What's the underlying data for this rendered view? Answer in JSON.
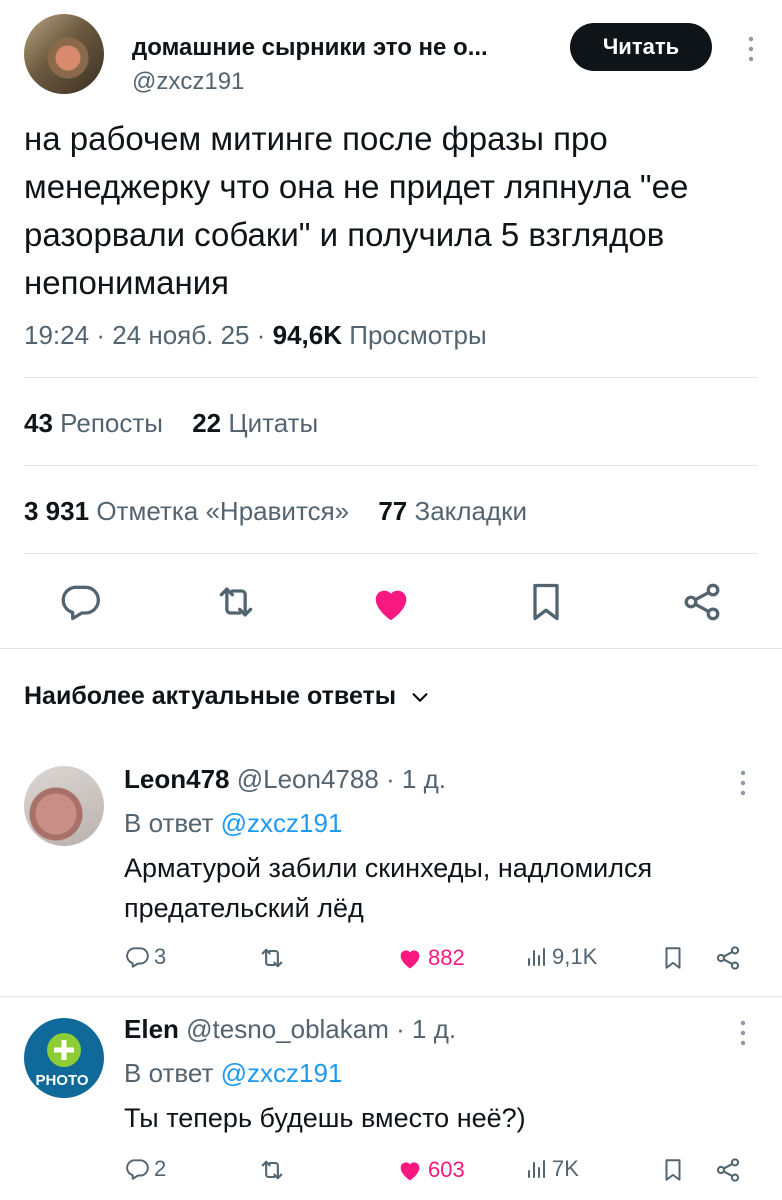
{
  "author": {
    "name": "домашние сырники это не о...",
    "handle": "@zxcz191",
    "read_button": "Читать"
  },
  "tweet": {
    "text": "на рабочем митинге после фразы про менеджерку что она не придет ляпнула \"ее разорвали собаки\" и получила 5 взглядов непонимания",
    "time": "19:24",
    "date": "24 нояб. 25",
    "views_count": "94,6K",
    "views_label": "Просмотры"
  },
  "stats": {
    "reposts_count": "43",
    "reposts_label": "Репосты",
    "quotes_count": "22",
    "quotes_label": "Цитаты",
    "likes_count": "3 931",
    "likes_label": "Отметка «Нравится»",
    "bookmarks_count": "77",
    "bookmarks_label": "Закладки"
  },
  "actions": [
    "reply-icon",
    "retweet-icon",
    "heart-icon",
    "bookmark-icon",
    "share-icon"
  ],
  "colors": {
    "like": "#f91880",
    "link": "#1d9bf0",
    "muted": "#536471",
    "text": "#0f1419"
  },
  "replies_header": {
    "label": "Наиболее актуальные ответы"
  },
  "replies": [
    {
      "name": "Leon478",
      "handle": "@Leon4788",
      "time": "· 1 д.",
      "reply_to_label": "В ответ",
      "reply_to_handle": "@zxcz191",
      "text": "Арматурой забили скинхеды, надломился предательский лёд",
      "replies": "3",
      "likes": "882",
      "views": "9,1K"
    },
    {
      "name": "Elen",
      "handle": "@tesno_oblakam",
      "time": "· 1 д.",
      "reply_to_label": "В ответ",
      "reply_to_handle": "@zxcz191",
      "text": "Ты теперь будешь вместо неё?)",
      "avatar_text": "PHOTO",
      "replies": "2",
      "likes": "603",
      "views": "7K"
    }
  ]
}
